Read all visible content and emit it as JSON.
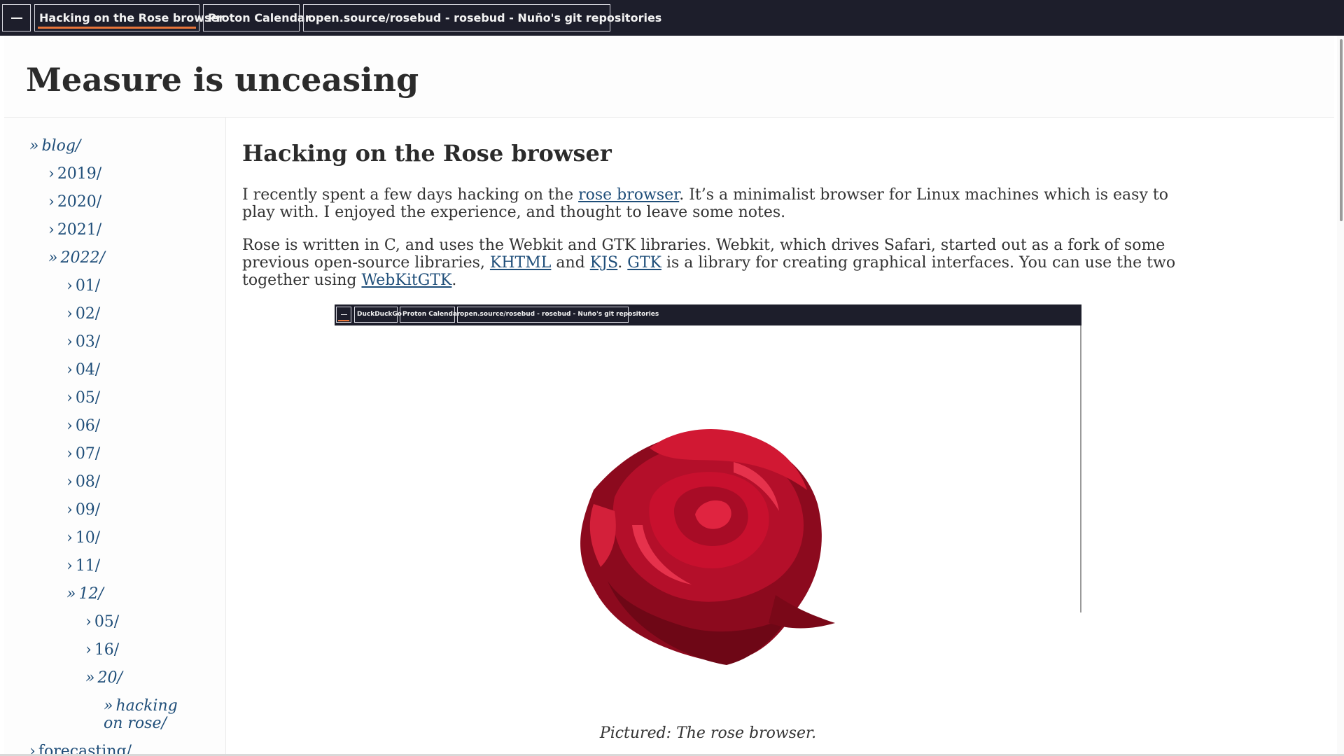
{
  "browser": {
    "menu_icon": "hamburger-icon",
    "tabs": [
      {
        "label": "Hacking on the Rose browser",
        "active": true
      },
      {
        "label": "Proton Calendar",
        "active": false
      },
      {
        "label": "open.source/rosebud - rosebud - Nuño's git repositories",
        "active": false
      }
    ]
  },
  "site": {
    "title": "Measure is unceasing"
  },
  "sidebar": {
    "items": [
      {
        "chevron": "»",
        "label": "blog/"
      },
      {
        "chevron": "›",
        "label": "2019/"
      },
      {
        "chevron": "›",
        "label": "2020/"
      },
      {
        "chevron": "›",
        "label": "2021/"
      },
      {
        "chevron": "»",
        "label": "2022/"
      },
      {
        "chevron": "›",
        "label": "01/"
      },
      {
        "chevron": "›",
        "label": "02/"
      },
      {
        "chevron": "›",
        "label": "03/"
      },
      {
        "chevron": "›",
        "label": "04/"
      },
      {
        "chevron": "›",
        "label": "05/"
      },
      {
        "chevron": "›",
        "label": "06/"
      },
      {
        "chevron": "›",
        "label": "07/"
      },
      {
        "chevron": "›",
        "label": "08/"
      },
      {
        "chevron": "›",
        "label": "09/"
      },
      {
        "chevron": "›",
        "label": "10/"
      },
      {
        "chevron": "›",
        "label": "11/"
      },
      {
        "chevron": "»",
        "label": "12/"
      },
      {
        "chevron": "›",
        "label": "05/"
      },
      {
        "chevron": "›",
        "label": "16/"
      },
      {
        "chevron": "»",
        "label": "20/"
      },
      {
        "chevron": "»",
        "label": "hacking on rose/"
      },
      {
        "chevron": "›",
        "label": "forecasting/"
      }
    ]
  },
  "post": {
    "title": "Hacking on the Rose browser",
    "p1": {
      "t1": "I recently spent a few days hacking on the ",
      "link1": "rose browser",
      "t2": ". It’s a minimalist browser for Linux machines which is easy to play with. I enjoyed the experience, and thought to leave some notes."
    },
    "p2": {
      "t1": "Rose is written in C, and uses the Webkit and GTK libraries. Webkit, which drives Safari, started out as a fork of some previous open-source libraries, ",
      "link1": "KHTML",
      "t2": " and ",
      "link2": "KJS",
      "t3": ". ",
      "link3": "GTK",
      "t4": " is a library for creating graphical interfaces. You can use the two together using ",
      "link4": "WebKitGTK",
      "t5": "."
    },
    "figure": {
      "tabs": [
        {
          "label": "DuckDuckGo"
        },
        {
          "label": "Proton Calendar"
        },
        {
          "label": "open.source/rosebud - rosebud - Nuño's git repositories"
        }
      ],
      "caption": "Pictured: The rose browser."
    }
  },
  "colors": {
    "tabbar_bg": "#1d1e2b",
    "tab_accent": "#e8753a",
    "link": "#1f4e79",
    "rose_red": "#c8102e"
  }
}
